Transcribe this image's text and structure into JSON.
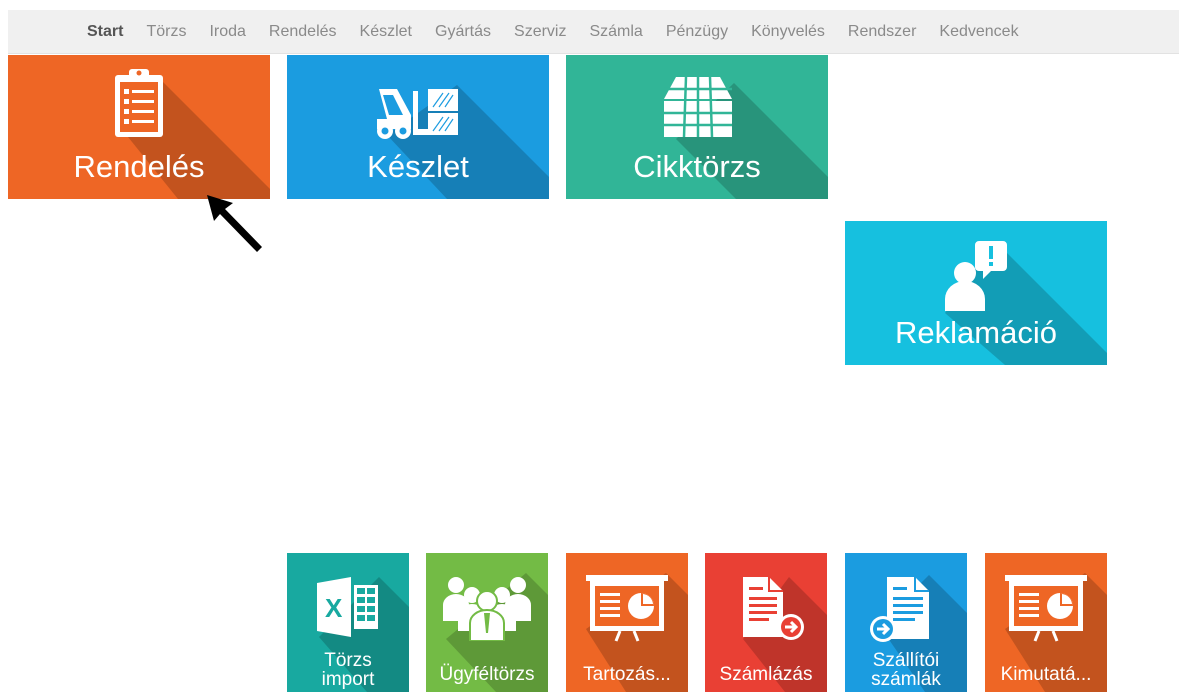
{
  "menu": {
    "items": [
      {
        "label": "Start",
        "active": true
      },
      {
        "label": "Törzs"
      },
      {
        "label": "Iroda"
      },
      {
        "label": "Rendelés"
      },
      {
        "label": "Készlet"
      },
      {
        "label": "Gyártás"
      },
      {
        "label": "Szerviz"
      },
      {
        "label": "Számla"
      },
      {
        "label": "Pénzügy"
      },
      {
        "label": "Könyvelés"
      },
      {
        "label": "Rendszer"
      },
      {
        "label": "Kedvencek"
      }
    ]
  },
  "tiles": {
    "rendeles": {
      "label": "Rendelés",
      "color": "#ee6625",
      "icon": "clipboard-list-icon"
    },
    "keszlet": {
      "label": "Készlet",
      "color": "#1b9ce0",
      "icon": "forklift-icon"
    },
    "cikktorzs": {
      "label": "Cikktörzs",
      "color": "#31b597",
      "icon": "boxes-icon"
    },
    "reklamacio": {
      "label": "Reklamáció",
      "color": "#16c0df",
      "icon": "user-alert-icon"
    },
    "torzs_import": {
      "label_line1": "Törzs",
      "label_line2": "import",
      "color": "#18a9a0",
      "icon": "excel-icon"
    },
    "ugyfeltorzs": {
      "label": "Ügyféltörzs",
      "color": "#73bb45",
      "icon": "people-group-icon"
    },
    "tartozas": {
      "label": "Tartozás...",
      "color": "#ee6625",
      "icon": "presentation-chart-icon"
    },
    "szamlazas": {
      "label": "Számlázás",
      "color": "#e94034",
      "icon": "invoice-send-icon"
    },
    "szallitoi_szamlak": {
      "label_line1": "Szállítói",
      "label_line2": "számlák",
      "color": "#1b9ce0",
      "icon": "invoice-receive-icon"
    },
    "kimutatas": {
      "label": "Kimutatá...",
      "color": "#ee6625",
      "icon": "presentation-chart-icon"
    }
  }
}
